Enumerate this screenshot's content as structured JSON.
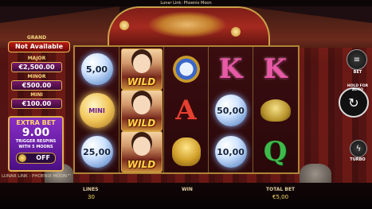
{
  "top_bar": {
    "title": "Lunar Link: Phoenix Moon"
  },
  "jackpots": {
    "grand": {
      "label": "GRAND",
      "value": "Not Available"
    },
    "major": {
      "label": "MAJOR",
      "value": "€2,500.00"
    },
    "minor": {
      "label": "MINOR",
      "value": "€500.00"
    },
    "mini": {
      "label": "MINI",
      "value": "€100.00"
    }
  },
  "extra_bet": {
    "title": "EXTRA BET",
    "value": "9.00",
    "description_line1": "TRIGGER RESPINS",
    "description_line2": "WITH 5 MOONS",
    "toggle": "OFF"
  },
  "game_name": "LUNAR LINK : PHOENIX MOON™",
  "reels": [
    [
      "5,00",
      "MINI",
      "25,00"
    ],
    [
      "WILD",
      "WILD",
      "WILD"
    ],
    [
      "clock-symbol",
      "A",
      "buddha-symbol"
    ],
    [
      "K",
      "50,00",
      "10,00"
    ],
    [
      "K",
      "toad-symbol",
      "Q"
    ]
  ],
  "reel_labels": {
    "wild": "WILD",
    "mini": "MINI",
    "moon_1": "5,00",
    "moon_2": "25,00",
    "moon_3": "50,00",
    "moon_4": "10,00",
    "letter_a": "A",
    "letter_k": "K",
    "letter_q": "Q"
  },
  "bottom_bar": {
    "lines_label": "LINES",
    "lines_value": "30",
    "win_label": "WIN",
    "total_bet_label": "TOTAL BET",
    "total_bet_value": "€5,00"
  },
  "right_controls": {
    "bet_label": "BET",
    "hold_label": "HOLD FOR AUTO",
    "turbo_label": "TURBO"
  }
}
